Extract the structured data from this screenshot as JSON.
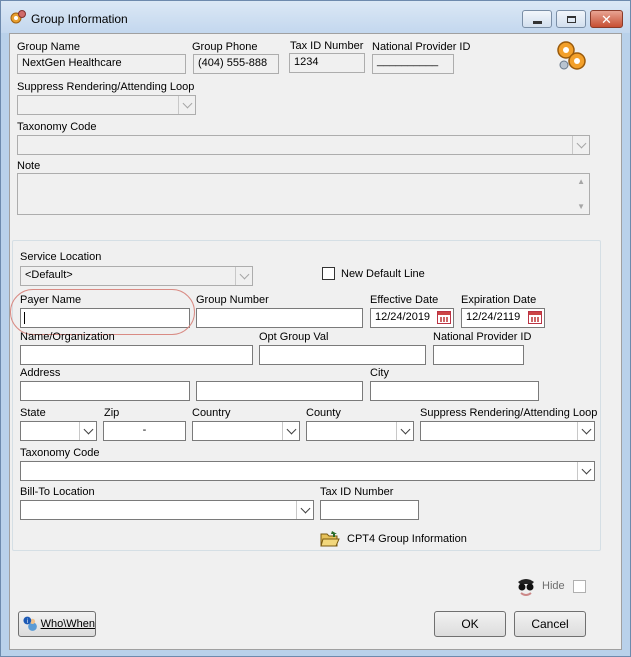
{
  "window": {
    "title": "Group Information",
    "minimize_icon": "minimize-icon",
    "maximize_icon": "maximize-icon",
    "close_icon": "close-icon"
  },
  "group": {
    "group_name_label": "Group Name",
    "group_name_value": "NextGen Healthcare",
    "group_phone_label": "Group Phone",
    "group_phone_value": "(404) 555-888",
    "tax_id_label": "Tax ID Number",
    "tax_id_value": "1234",
    "npi_label": "National Provider ID",
    "npi_value": "__________",
    "suppress_label": "Suppress Rendering/Attending Loop",
    "taxonomy_label": "Taxonomy Code",
    "note_label": "Note"
  },
  "location": {
    "service_location_label": "Service Location",
    "service_location_value": "<Default>",
    "new_default_line_label": "New Default Line",
    "payer_name_label": "Payer Name",
    "group_number_label": "Group Number",
    "effective_date_label": "Effective Date",
    "effective_date_value": "12/24/2019",
    "expiration_date_label": "Expiration Date",
    "expiration_date_value": "12/24/2119",
    "name_org_label": "Name/Organization",
    "opt_group_val_label": "Opt Group Val",
    "npi_label": "National Provider ID",
    "address_label": "Address",
    "city_label": "City",
    "state_label": "State",
    "zip_label": "Zip",
    "zip_value": "-",
    "country_label": "Country",
    "county_label": "County",
    "suppress_label": "Suppress Rendering/Attending Loop",
    "taxonomy_label": "Taxonomy Code",
    "bill_to_label": "Bill-To Location",
    "tax_id_label": "Tax ID Number",
    "cpt4_label": "CPT4 Group Information"
  },
  "footer": {
    "hide_label": "Hide",
    "whowhen_label": "Who\\When",
    "ok_label": "OK",
    "cancel_label": "Cancel"
  }
}
